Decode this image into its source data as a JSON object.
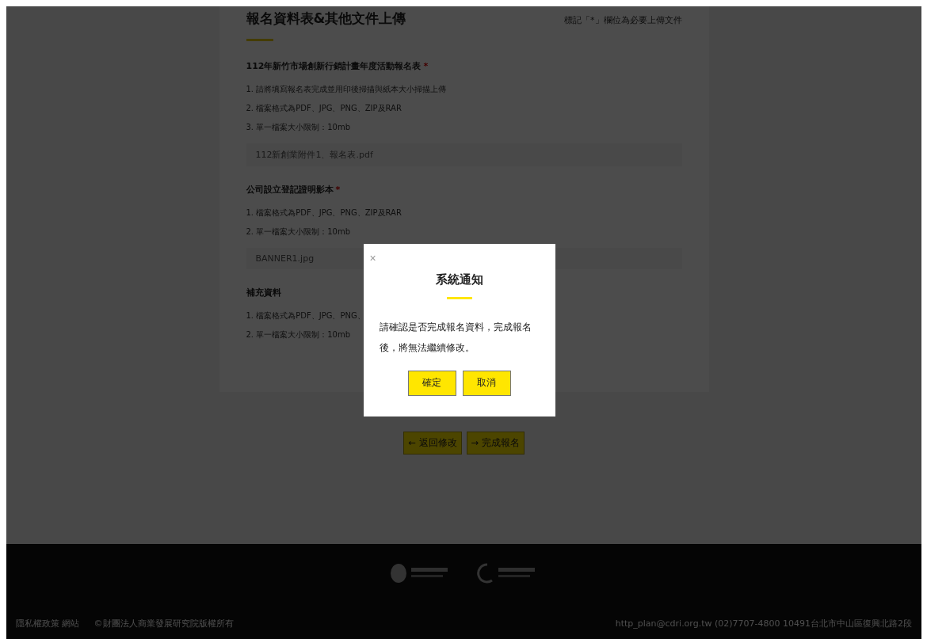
{
  "upload_section": {
    "title": "報名資料表&其他文件上傳",
    "note": "標記「*」欄位為必要上傳文件",
    "fields": [
      {
        "label": "112年新竹市場創新行銷計畫年度活動報名表",
        "required_mark": "*",
        "instructions": [
          "1. 請將填寫報名表完成並用印後掃描與紙本大小掃描上傳",
          "2. 檔案格式為PDF、JPG、PNG、ZIP及RAR",
          "3. 單一檔案大小限制：10mb"
        ],
        "file": "112新創業附件1、報名表.pdf"
      },
      {
        "label": "公司設立登記證明影本",
        "required_mark": "*",
        "instructions": [
          "1. 檔案格式為PDF、JPG、PNG、ZIP及RAR",
          "2. 單一檔案大小限制：10mb"
        ],
        "file": "BANNER1.jpg"
      },
      {
        "label": "補充資料",
        "instructions": [
          "1. 檔案格式為PDF、JPG、PNG、",
          "2. 單一檔案大小限制：10mb"
        ]
      }
    ]
  },
  "nav_buttons": [
    {
      "arrow": "←",
      "label": "返回修改"
    },
    {
      "arrow": "→",
      "label": "完成報名"
    }
  ],
  "footer": {
    "links": "隱私權政策 網站",
    "copyright": "©財團法人商業發展研究院版權所有",
    "contact": "http_plan@cdri.org.tw  (02)7707-4800  10491台北市中山區復興北路2段"
  },
  "modal": {
    "close": "×",
    "title": "系統通知",
    "message": "請確認是否完成報名資料，完成報名後，將無法繼續修改。",
    "buttons": [
      "確定",
      "取消"
    ]
  }
}
